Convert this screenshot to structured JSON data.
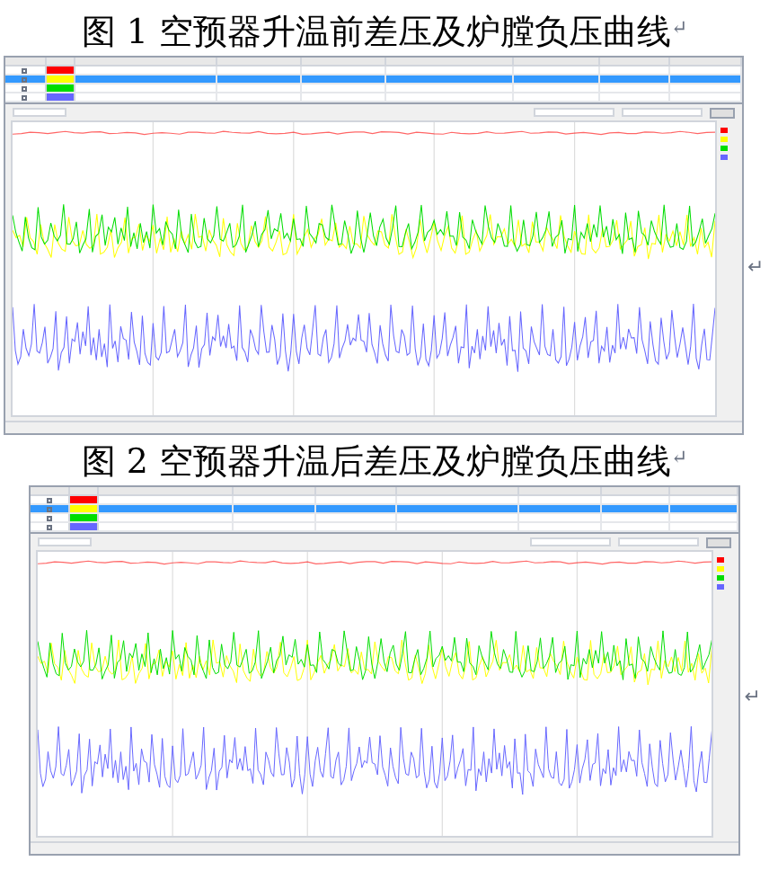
{
  "figures": [
    {
      "caption": "图 1 空预器升温前差压及炉膛负压曲线",
      "mark": "↵",
      "side_mark": "↵",
      "rows": [
        {
          "color": "#ff0000",
          "selected": false
        },
        {
          "color": "#ffff00",
          "selected": true
        },
        {
          "color": "#00dd00",
          "selected": false
        },
        {
          "color": "#6666ff",
          "selected": false
        }
      ]
    },
    {
      "caption": "图 2 空预器升温后差压及炉膛负压曲线",
      "mark": "↵",
      "side_mark": "↵",
      "rows": [
        {
          "color": "#ff0000",
          "selected": false
        },
        {
          "color": "#ffff00",
          "selected": true
        },
        {
          "color": "#00dd00",
          "selected": false
        },
        {
          "color": "#6666ff",
          "selected": false
        }
      ]
    }
  ]
}
